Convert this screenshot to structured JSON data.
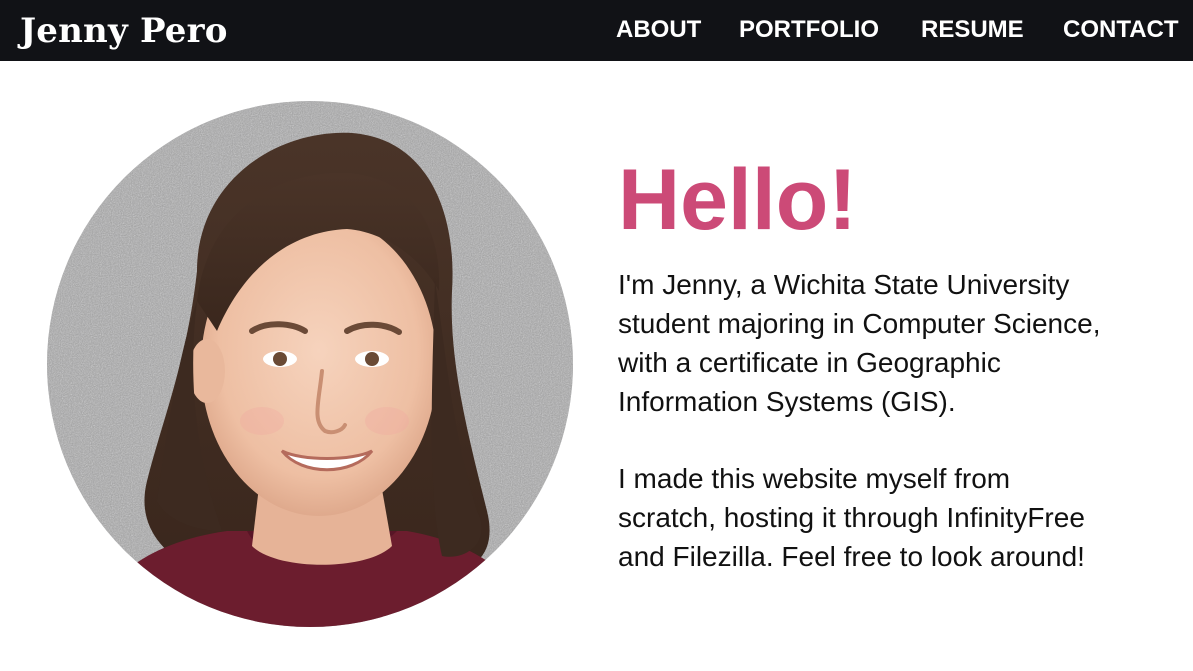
{
  "header": {
    "brand": "Jenny Pero",
    "nav": [
      {
        "label": "ABOUT"
      },
      {
        "label": "PORTFOLIO"
      },
      {
        "label": "RESUME"
      },
      {
        "label": "CONTACT"
      }
    ]
  },
  "main": {
    "greeting": "Hello!",
    "paragraphs": [
      "I'm Jenny, a Wichita State University\nstudent majoring in Computer Science,\nwith a certificate in Geographic\nInformation Systems (GIS).",
      "I made this website myself from\nscratch, hosting it through InfinityFree\nand Filezilla. Feel free to look around!"
    ]
  },
  "colors": {
    "navbar_bg": "#111216",
    "accent": "#cc4a77",
    "text": "#111111",
    "background": "#ffffff"
  }
}
